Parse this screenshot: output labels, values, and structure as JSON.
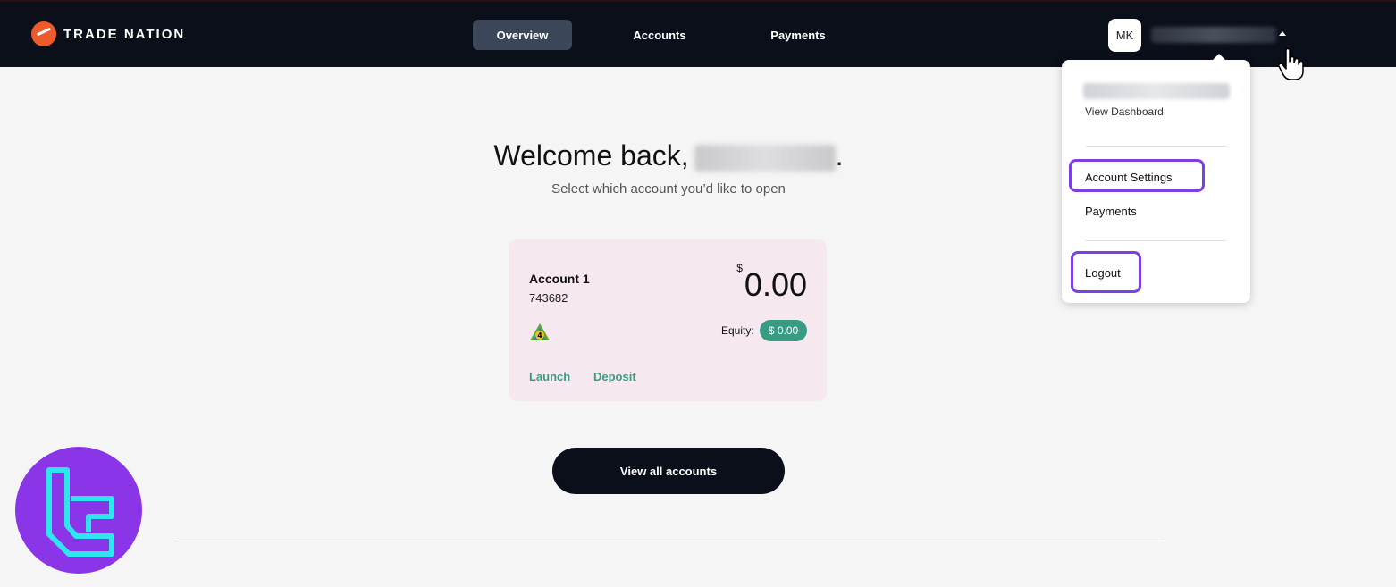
{
  "brand": {
    "name": "TRADE NATION",
    "accent": "#ef5a2a"
  },
  "nav": {
    "overview": "Overview",
    "accounts": "Accounts",
    "payments": "Payments"
  },
  "user": {
    "initials": "MK"
  },
  "dropdown": {
    "view_dashboard": "View Dashboard",
    "account_settings": "Account Settings",
    "payments": "Payments",
    "logout": "Logout",
    "highlight_color": "#7b3fe4"
  },
  "main": {
    "welcome": "Welcome back,",
    "welcome_suffix": ".",
    "subtitle": "Select which account you’d like to open",
    "view_all": "View all accounts"
  },
  "account_card": {
    "name": "Account 1",
    "number": "743682",
    "currency_symbol": "$",
    "balance": "0.00",
    "equity_label": "Equity:",
    "equity_value": "$ 0.00",
    "launch": "Launch",
    "deposit": "Deposit",
    "platform_icon": "mt4-icon",
    "equity_color": "#3a9b84"
  },
  "watermark": {
    "icon": "tc-logo-icon",
    "color": "#8a35e8"
  }
}
